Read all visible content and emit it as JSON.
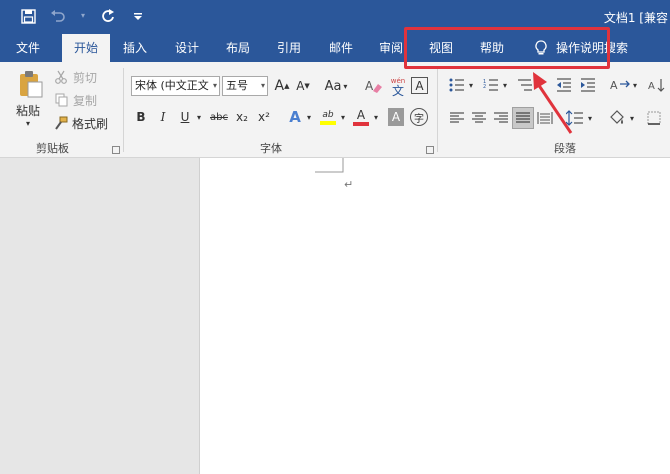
{
  "title_bar": {
    "document_title": "文档1 [兼容"
  },
  "quick_access": {
    "save_icon": "save-icon",
    "undo_icon": "undo-icon",
    "redo_icon": "redo-icon",
    "customize_icon": "customize-qat-icon"
  },
  "tabs": [
    {
      "label": "文件"
    },
    {
      "label": "开始"
    },
    {
      "label": "插入"
    },
    {
      "label": "设计"
    },
    {
      "label": "布局"
    },
    {
      "label": "引用"
    },
    {
      "label": "邮件"
    },
    {
      "label": "审阅"
    },
    {
      "label": "视图"
    },
    {
      "label": "帮助"
    },
    {
      "label": "操作说明搜索"
    }
  ],
  "active_tab": "开始",
  "clipboard": {
    "paste_label": "粘贴",
    "cut_label": "剪切",
    "copy_label": "复制",
    "format_painter_label": "格式刷",
    "group_label": "剪贴板"
  },
  "font": {
    "font_name": "宋体 (中文正文",
    "font_size": "五号",
    "group_label": "字体",
    "bold": "B",
    "italic": "I",
    "underline": "U",
    "strike": "abc",
    "subscript": "x₂",
    "superscript": "x²",
    "change_case": "Aa",
    "phonetic": "wén",
    "phonetic_char": "文",
    "char_border": "A",
    "char_shading": "A",
    "enclose": "字",
    "grow_font": "A",
    "shrink_font": "A",
    "text_effect": "A",
    "highlight": "ab",
    "font_color": "A"
  },
  "paragraph": {
    "group_label": "段落"
  },
  "colors": {
    "title_bar": "#2b579a",
    "ribbon": "#f3f3f3",
    "highlight_box": "#e0333c",
    "font_color_bar": "#e0333c",
    "highlight_color_bar": "#ffff00"
  },
  "document": {
    "paragraph_mark": "↵"
  }
}
